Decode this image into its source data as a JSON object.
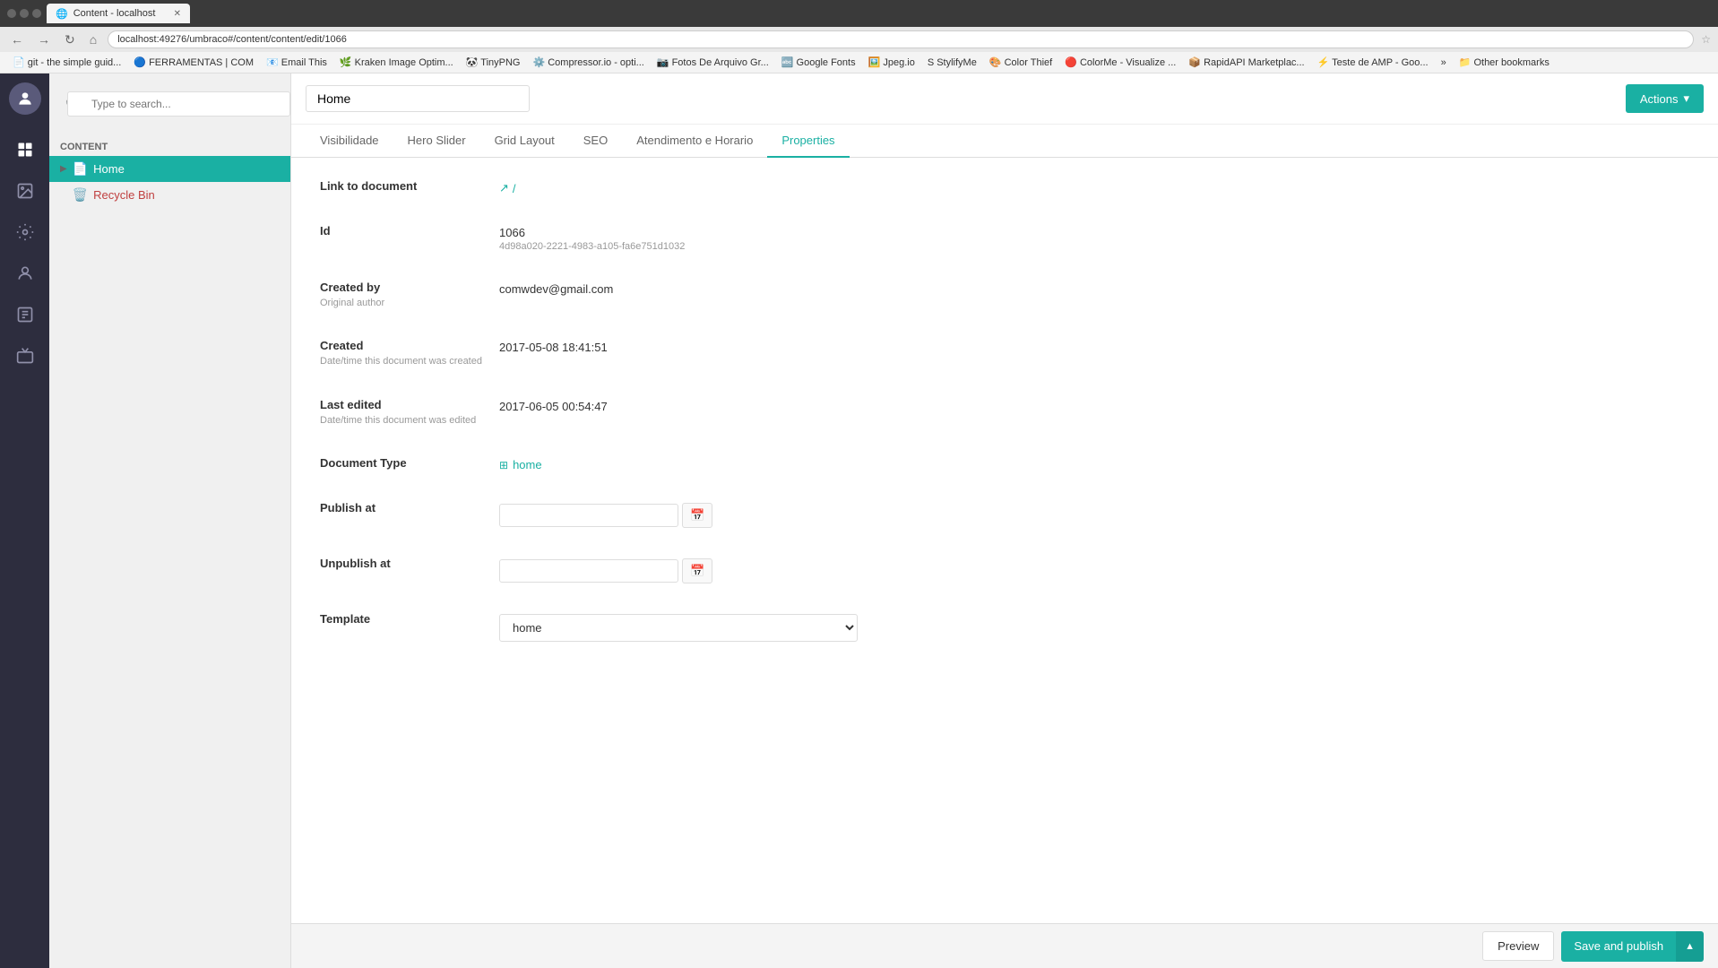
{
  "browser": {
    "tab_label": "Content - localhost",
    "url": "localhost:49276/umbraco#/content/content/edit/1066",
    "bookmarks": [
      {
        "label": "git - the simple guid..."
      },
      {
        "label": "FERRAMENTAS | COM"
      },
      {
        "label": "Email This"
      },
      {
        "label": "Kraken Image Optim..."
      },
      {
        "label": "TinyPNG"
      },
      {
        "label": "Compressor.io - opti..."
      },
      {
        "label": "Fotos De Arquivo Gr..."
      },
      {
        "label": "Google Fonts"
      },
      {
        "label": "Jpeg.io"
      },
      {
        "label": "StylifyMe"
      },
      {
        "label": "Color Thief"
      },
      {
        "label": "ColorMe - Visualize ..."
      },
      {
        "label": "RapidAPI Marketplac..."
      },
      {
        "label": "Teste de AMP - Goo..."
      },
      {
        "label": "»"
      },
      {
        "label": "Other bookmarks"
      }
    ]
  },
  "sidebar": {
    "search_placeholder": "Type to search...",
    "section_label": "Content",
    "tree_items": [
      {
        "label": "Home",
        "active": true,
        "type": "document"
      },
      {
        "label": "Recycle Bin",
        "active": false,
        "type": "recycle"
      }
    ]
  },
  "header": {
    "page_title": "Home",
    "actions_label": "Actions"
  },
  "tabs": [
    {
      "label": "Visibilidade",
      "active": false
    },
    {
      "label": "Hero Slider",
      "active": false
    },
    {
      "label": "Grid Layout",
      "active": false
    },
    {
      "label": "SEO",
      "active": false
    },
    {
      "label": "Atendimento e Horario",
      "active": false
    },
    {
      "label": "Properties",
      "active": true
    }
  ],
  "properties": {
    "link_to_document": {
      "label": "Link to document",
      "value": "/",
      "link_icon": "🔗"
    },
    "id": {
      "label": "Id",
      "value": "1066",
      "secondary": "4d98a020-2221-4983-a105-fa6e751d1032"
    },
    "created_by": {
      "label": "Created by",
      "sublabel": "Original author",
      "value": "comwdev@gmail.com"
    },
    "created": {
      "label": "Created",
      "sublabel": "Date/time this document was created",
      "value": "2017-05-08 18:41:51"
    },
    "last_edited": {
      "label": "Last edited",
      "sublabel": "Date/time this document was edited",
      "value": "2017-06-05 00:54:47"
    },
    "document_type": {
      "label": "Document Type",
      "value": "home"
    },
    "publish_at": {
      "label": "Publish at",
      "value": "",
      "placeholder": ""
    },
    "unpublish_at": {
      "label": "Unpublish at",
      "value": "",
      "placeholder": ""
    },
    "template": {
      "label": "Template",
      "value": "home",
      "options": [
        "home"
      ]
    }
  },
  "bottom_bar": {
    "preview_label": "Preview",
    "publish_label": "Save and publish"
  }
}
